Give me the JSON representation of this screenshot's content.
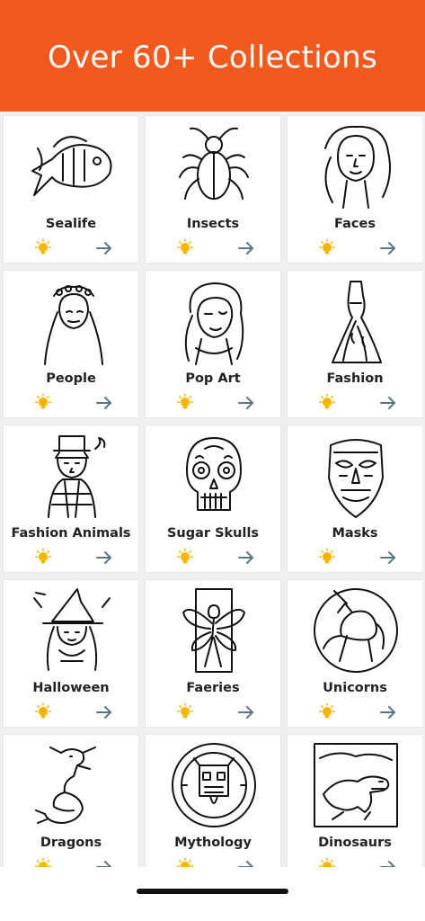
{
  "header": {
    "title": "Over 60+ Collections"
  },
  "icons": {
    "tip": "lightbulb-icon",
    "open": "arrow-right-icon"
  },
  "colors": {
    "brand": "#f2591f",
    "bulb": "#f7b500",
    "arrow": "#5d7685"
  },
  "collections": [
    {
      "label": "Sealife",
      "art": "fish"
    },
    {
      "label": "Insects",
      "art": "beetle"
    },
    {
      "label": "Faces",
      "art": "face"
    },
    {
      "label": "People",
      "art": "person"
    },
    {
      "label": "Pop Art",
      "art": "popart"
    },
    {
      "label": "Fashion",
      "art": "dress"
    },
    {
      "label": "Fashion Animals",
      "art": "cat"
    },
    {
      "label": "Sugar Skulls",
      "art": "skull"
    },
    {
      "label": "Masks",
      "art": "mask"
    },
    {
      "label": "Halloween",
      "art": "witch"
    },
    {
      "label": "Faeries",
      "art": "fairy"
    },
    {
      "label": "Unicorns",
      "art": "unicorn"
    },
    {
      "label": "Dragons",
      "art": "dragon"
    },
    {
      "label": "Mythology",
      "art": "aztec"
    },
    {
      "label": "Dinosaurs",
      "art": "dino"
    }
  ]
}
